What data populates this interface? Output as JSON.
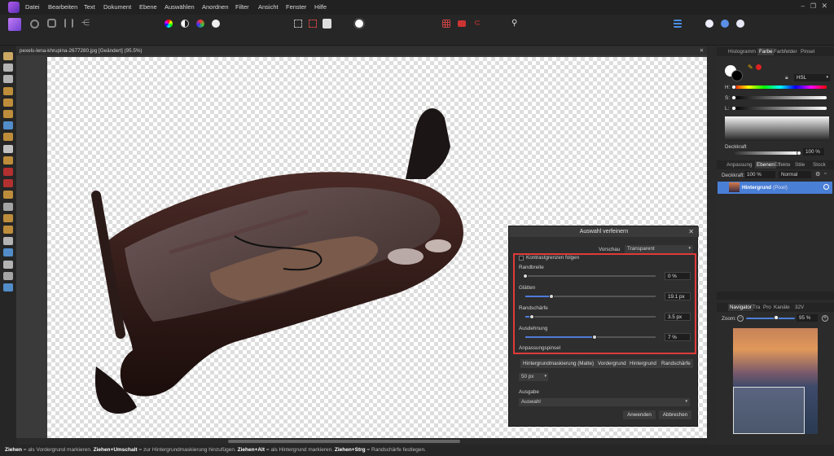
{
  "menu": [
    "Datei",
    "Bearbeiten",
    "Text",
    "Dokument",
    "Ebene",
    "Auswählen",
    "Anordnen",
    "Filter",
    "Ansicht",
    "Fenster",
    "Hilfe"
  ],
  "document": {
    "tab_title": "pexels-lena-khrupina-2677280.jpg [Geändert] (95.5%)"
  },
  "panels": {
    "top_tabs": [
      "Histogramm",
      "Farbe",
      "Farbfelder",
      "Pinsel"
    ],
    "color_mode": "HSL",
    "labels": {
      "h": "H:",
      "s": "S:",
      "l": "L:"
    },
    "opacity_label": "Deckkraft",
    "opacity_value": "100 %",
    "layer_tabs": [
      "Anpassung",
      "Ebenen",
      "Effekte",
      "Stile",
      "Stock"
    ],
    "layer_opacity_label": "Deckkraft:",
    "layer_opacity_value": "100 %",
    "blend_mode": "Normal",
    "layer_name": "Hintergrund",
    "layer_type": "(Pixel)",
    "nav_tabs": [
      "Navigator",
      "Tra",
      "Pro",
      "Kanäle",
      "32V"
    ],
    "zoom_label": "Zoom:",
    "zoom_value": "95 %",
    "icons": [
      "swap-icon",
      "eyedropper-icon",
      "lock-icon",
      "settings-icon",
      "add-layer-icon",
      "trash-icon"
    ]
  },
  "dialog": {
    "title": "Auswahl verfeinern",
    "preview_label": "Vorschau",
    "preview_value": "Transparent",
    "contrast_label": "Kontrastgrenzen folgen",
    "sliders": [
      {
        "label": "Randbreite",
        "value": "0 %",
        "fraction": 0.0
      },
      {
        "label": "Glätten",
        "value": "19.1 px",
        "fraction": 0.2
      },
      {
        "label": "Randschärfe",
        "value": "3.5 px",
        "fraction": 0.05
      },
      {
        "label": "Ausdehnung",
        "value": "7 %",
        "fraction": 0.53
      }
    ],
    "brush_label": "Anpassungspinsel",
    "brush_modes": [
      "Hintergrundmaskierung (Matte)",
      "Vordergrund",
      "Hintergrund",
      "Randschärfe"
    ],
    "brush_size": "50 px",
    "output_label": "Ausgabe",
    "output_value": "Auswahl",
    "apply": "Anwenden",
    "cancel": "Abbrechen",
    "highlight_color": "#e03a3a"
  },
  "status": {
    "parts": [
      {
        "b": "Ziehen"
      },
      {
        "t": " = als Vordergrund markieren. "
      },
      {
        "b": "Ziehen+Umschalt"
      },
      {
        "t": " = zur Hintergrundmaskierung hinzufügen. "
      },
      {
        "b": "Ziehen+Alt"
      },
      {
        "t": " = als Hintergrund markieren. "
      },
      {
        "b": "Ziehen+Strg"
      },
      {
        "t": " = Randschärfe festlegen."
      }
    ]
  },
  "colors": {
    "accent": "#4a7fd6",
    "bg": "#2b2b2b",
    "menubar": "#212121"
  }
}
